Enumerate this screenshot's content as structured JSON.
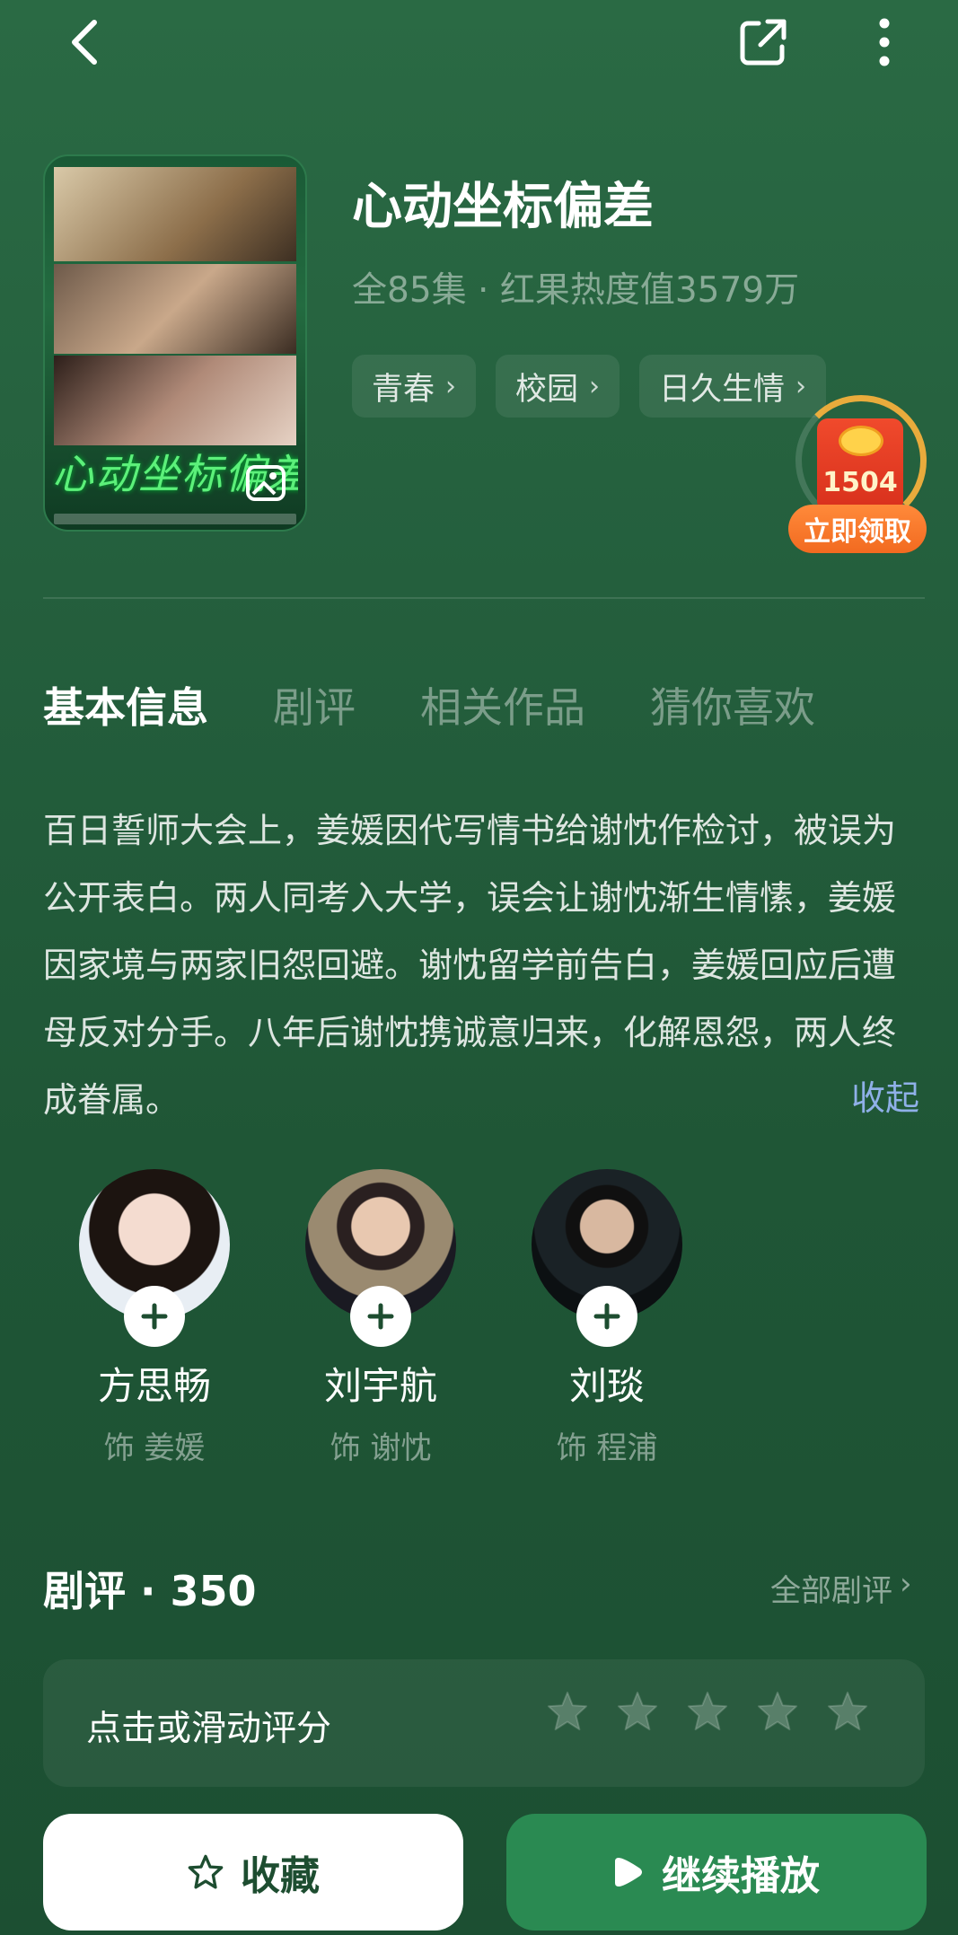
{
  "drama": {
    "title": "心动坐标偏差",
    "meta": "全85集 · 红果热度值3579万",
    "tags": [
      "青春",
      "校园",
      "日久生情"
    ],
    "poster_title": "心动坐标偏差"
  },
  "reward": {
    "count": "1504",
    "claim_label": "立即领取"
  },
  "tabs": [
    "基本信息",
    "剧评",
    "相关作品",
    "猜你喜欢"
  ],
  "synopsis": "百日誓师大会上，姜媛因代写情书给谢忱作检讨，被误为公开表白。两人同考入大学，误会让谢忱渐生情愫，姜媛因家境与两家旧怨回避。谢忱留学前告白，姜媛回应后遭母反对分手。八年后谢忱携诚意归来，化解恩怨，两人终成眷属。",
  "collapse_label": "收起",
  "cast": [
    {
      "name": "方思畅",
      "role": "饰 姜媛"
    },
    {
      "name": "刘宇航",
      "role": "饰 谢忱"
    },
    {
      "name": "刘琰",
      "role": "饰 程浦"
    }
  ],
  "reviews": {
    "title": "剧评 · 350",
    "all_label": "全部剧评",
    "rating_prompt": "点击或滑动评分",
    "star_count": 5
  },
  "actions": {
    "favorite_label": "收藏",
    "play_label": "继续播放"
  },
  "colors": {
    "accent_green": "#2a8a52",
    "link_blue": "#8fb0e8",
    "claim_orange": "#f26a20"
  },
  "icons": [
    "back-arrow-icon",
    "share-icon",
    "more-vertical-icon",
    "gallery-icon",
    "plus-icon",
    "star-icon",
    "play-icon",
    "chevron-right-icon"
  ]
}
